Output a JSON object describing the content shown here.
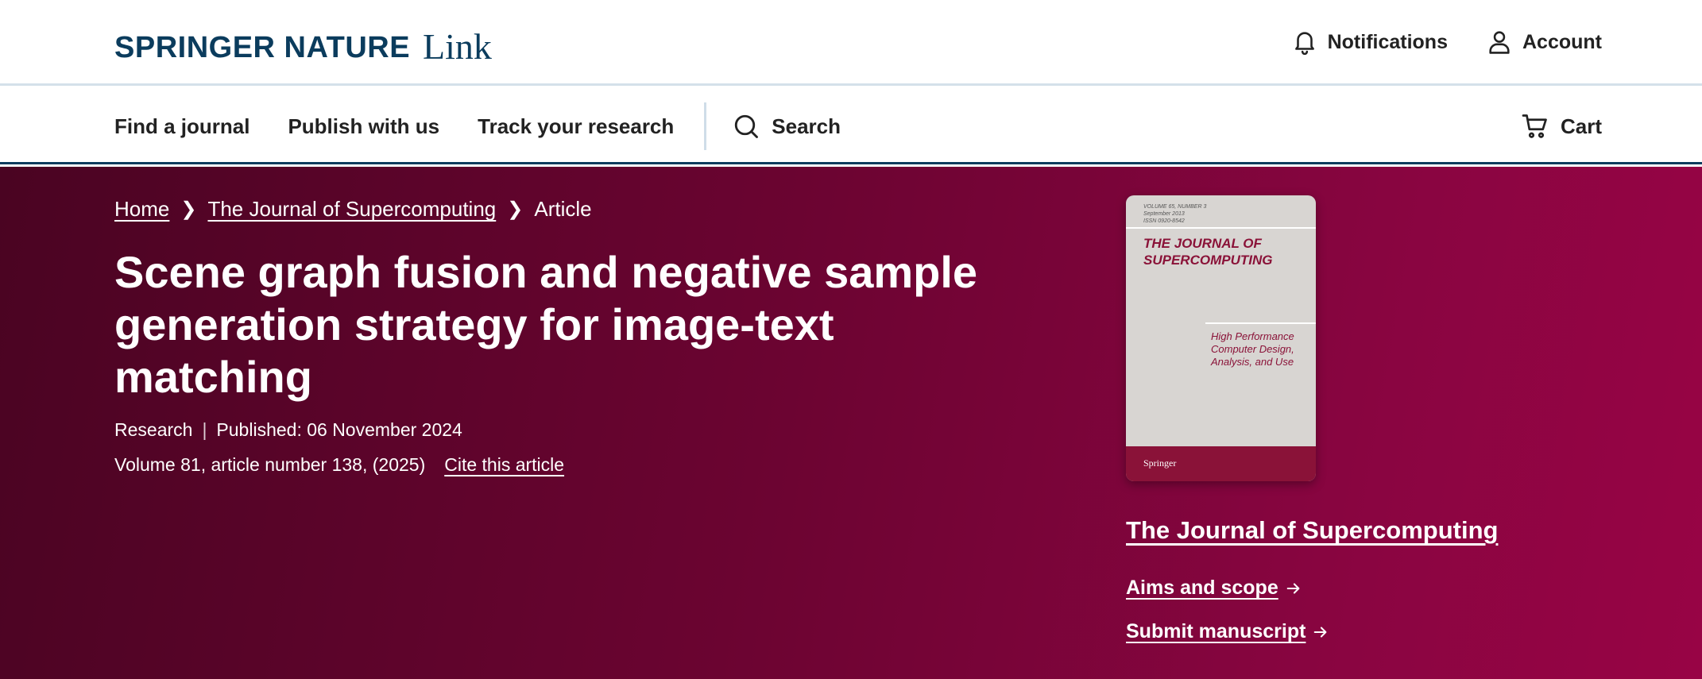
{
  "header": {
    "brand_main": "SPRINGER NATURE",
    "brand_link": "Link",
    "notifications_label": "Notifications",
    "account_label": "Account"
  },
  "nav": {
    "items": [
      {
        "label": "Find a journal"
      },
      {
        "label": "Publish with us"
      },
      {
        "label": "Track your research"
      }
    ],
    "search_label": "Search",
    "cart_label": "Cart"
  },
  "breadcrumb": {
    "home": "Home",
    "journal": "The Journal of Supercomputing",
    "current": "Article"
  },
  "article": {
    "title": "Scene graph fusion and negative sample generation strategy for image-text matching",
    "type": "Research",
    "published": "Published: 06 November 2024",
    "citation": "Volume 81, article number 138, (2025)",
    "cite_link": "Cite this article"
  },
  "journal": {
    "cover": {
      "volume_line1": "VOLUME 65, NUMBER 3",
      "volume_line2": "September 2013",
      "volume_line3": "ISSN 0920-8542",
      "title_line1": "THE JOURNAL OF",
      "title_line2": "SUPERCOMPUTING",
      "subtitle": "High Performance Computer Design, Analysis, and Use",
      "publisher": "Springer"
    },
    "name": "The Journal of Supercomputing",
    "aims_label": "Aims and scope",
    "submit_label": "Submit manuscript"
  },
  "colors": {
    "brand_navy": "#0b3c5d",
    "hero_start": "#4a0422",
    "hero_end": "#980445",
    "cover_accent": "#8a1238"
  }
}
